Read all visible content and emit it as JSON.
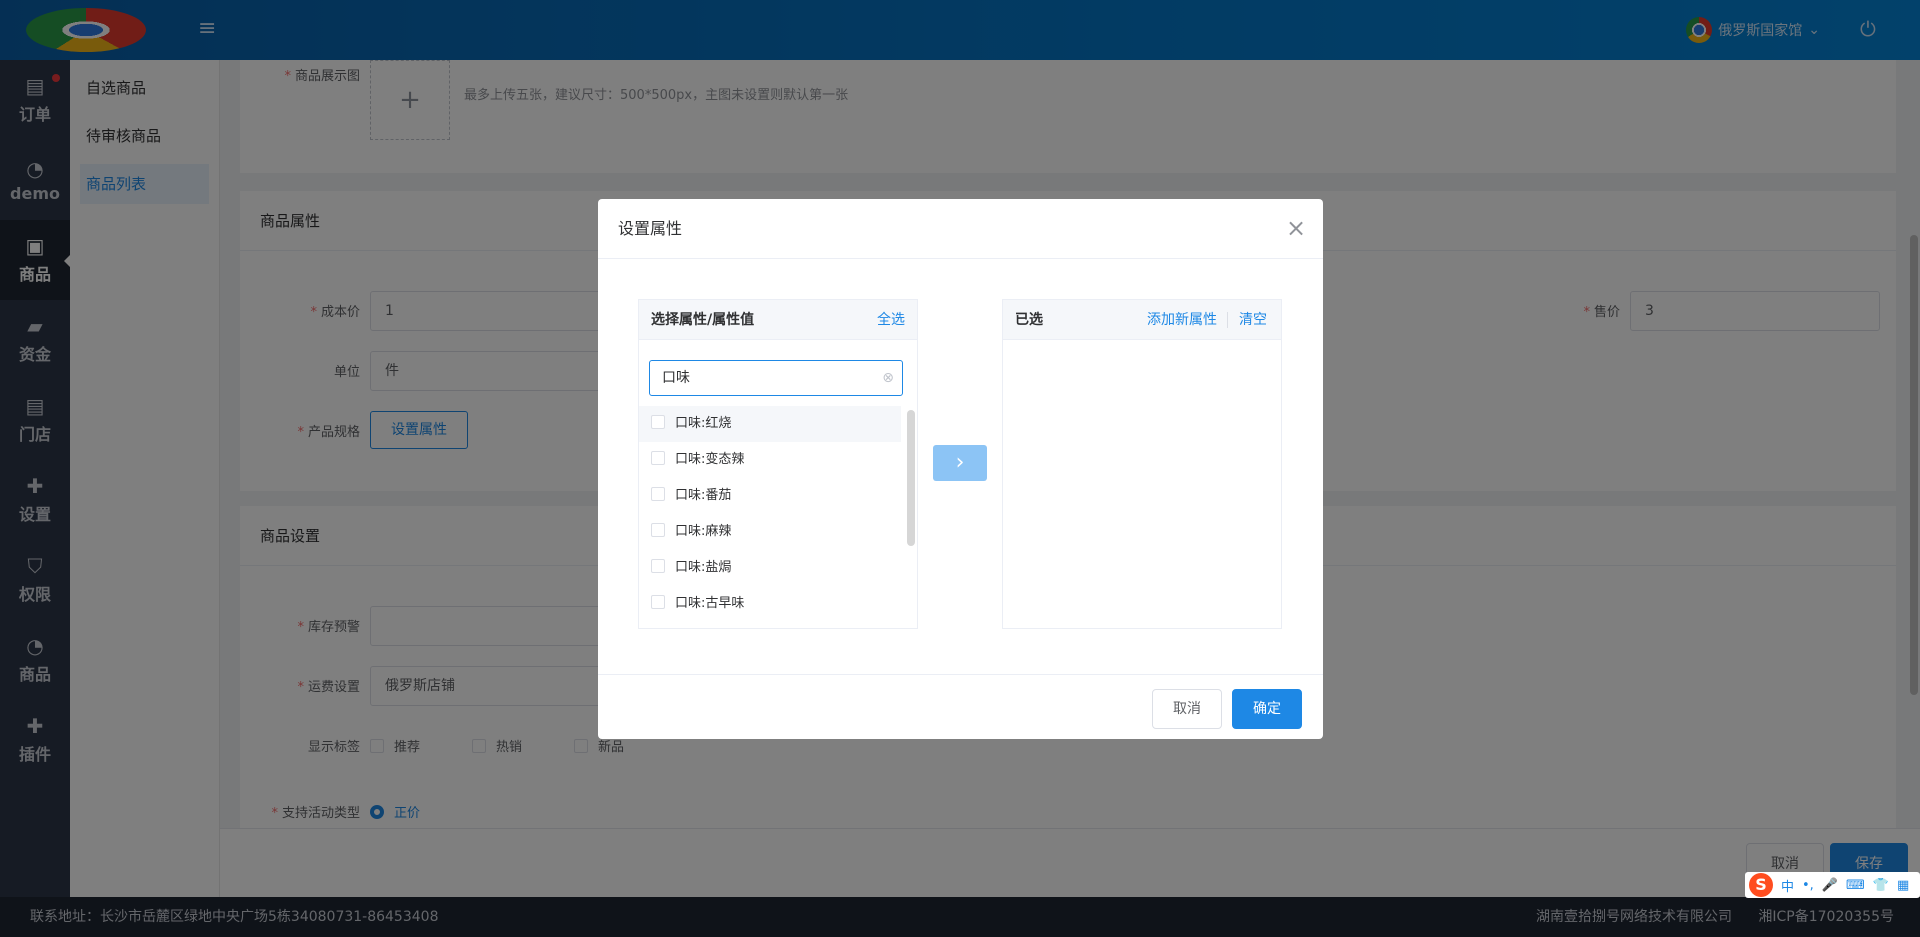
{
  "header": {
    "store_name": "俄罗斯国家馆",
    "hamburger_glyph": "≡",
    "power_glyph": "⏻",
    "dropdown_glyph": "⌄"
  },
  "nav": {
    "items": [
      {
        "label": "订单",
        "icon": "clipboard-icon",
        "glyph": "▤",
        "badge": true
      },
      {
        "label": "demo",
        "icon": "pie-chart-icon",
        "glyph": "◔"
      },
      {
        "label": "商品",
        "icon": "bag-icon",
        "glyph": "▣",
        "active": true
      },
      {
        "label": "资金",
        "icon": "wallet-icon",
        "glyph": "▰"
      },
      {
        "label": "门店",
        "icon": "clipboard-icon",
        "glyph": "▤"
      },
      {
        "label": "设置",
        "icon": "puzzle-icon",
        "glyph": "✚"
      },
      {
        "label": "权限",
        "icon": "shield-icon",
        "glyph": "⛉"
      },
      {
        "label": "商品",
        "icon": "pie-chart-icon",
        "glyph": "◔"
      },
      {
        "label": "插件",
        "icon": "puzzle-icon",
        "glyph": "✚"
      }
    ]
  },
  "submenu": {
    "items": [
      {
        "label": "自选商品"
      },
      {
        "label": "待审核商品"
      },
      {
        "label": "商品列表",
        "active": true
      }
    ]
  },
  "form": {
    "display_images_label": "商品展示图",
    "upload_plus": "+",
    "upload_hint": "最多上传五张，建议尺寸：500*500px，主图未设置则默认第一张",
    "attributes_title": "商品属性",
    "cost_label": "成本价",
    "cost_value": "1",
    "price_label": "售价",
    "price_value": "3",
    "unit_label": "单位",
    "unit_value": "件",
    "spec_label": "产品规格",
    "spec_button": "设置属性",
    "settings_title": "商品设置",
    "stock_alert_label": "库存预警",
    "shipping_label": "运费设置",
    "shipping_value": "俄罗斯店铺",
    "tags_label": "显示标签",
    "tags": [
      "推荐",
      "热销",
      "新品"
    ],
    "activity_label": "支持活动类型",
    "activity_value": "正价",
    "cancel_button": "取消",
    "save_button": "保存"
  },
  "footer": {
    "address": "联系地址：长沙市岳麓区绿地中央广场5栋34080731-86453408",
    "company": "湖南壹拾捌号网络技术有限公司",
    "icp": "湘ICP备17020355号"
  },
  "dialog": {
    "title": "设置属性",
    "close_glyph": "×",
    "left_panel": {
      "title": "选择属性/属性值",
      "select_all": "全选",
      "search_value": "口味",
      "clear_glyph": "⊗",
      "options": [
        "口味:红烧",
        "口味:变态辣",
        "口味:番茄",
        "口味:麻辣",
        "口味:盐焗",
        "口味:古早味"
      ]
    },
    "transfer_glyph": "›",
    "right_panel": {
      "title": "已选",
      "add_new": "添加新属性",
      "clear": "清空"
    },
    "cancel_button": "取消",
    "confirm_button": "确定"
  },
  "ime": {
    "logo": "S",
    "lang": "中",
    "punct": "•,",
    "glyphs": [
      "🎤",
      "⌨",
      "👕",
      "▦"
    ]
  }
}
